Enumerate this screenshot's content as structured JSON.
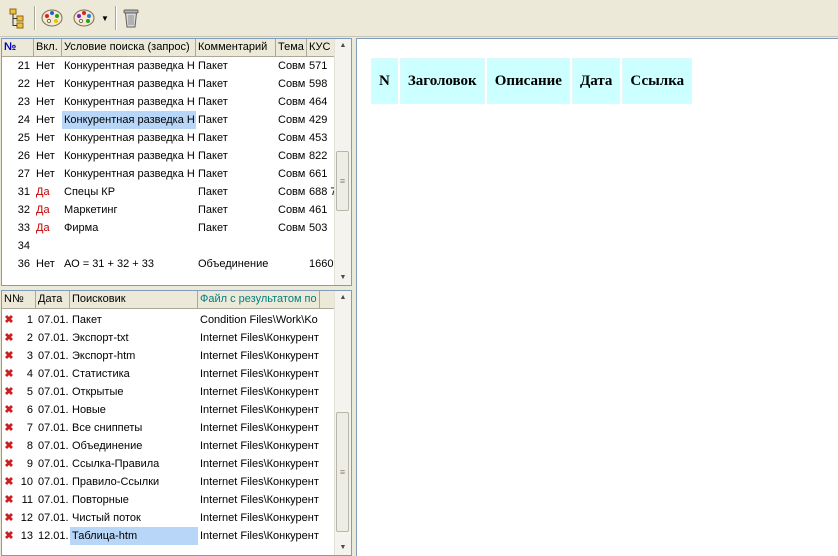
{
  "toolbar": {
    "buttons": [
      {
        "name": "tree-view-button",
        "icon": "tree-icon"
      },
      {
        "name": "palette-button",
        "icon": "palette-icon"
      },
      {
        "name": "palette-dropdown-button",
        "icon": "palette-dropdown-icon"
      },
      {
        "name": "trash-button",
        "icon": "trash-icon"
      }
    ]
  },
  "queries": {
    "headers": [
      "№",
      "Вкл.",
      "Условие поиска (запрос)",
      "Комментарий",
      "Тема",
      "КУС"
    ],
    "rows": [
      {
        "n": "21",
        "on": "Нет",
        "cond": "Конкурентная разведка Н",
        "comment": "Пакет",
        "theme": "Совм",
        "kus": "571",
        "on_red": false,
        "selected": false
      },
      {
        "n": "22",
        "on": "Нет",
        "cond": "Конкурентная разведка Н",
        "comment": "Пакет",
        "theme": "Совм",
        "kus": "598",
        "on_red": false,
        "selected": false
      },
      {
        "n": "23",
        "on": "Нет",
        "cond": "Конкурентная разведка Н",
        "comment": "Пакет",
        "theme": "Совм",
        "kus": "464",
        "on_red": false,
        "selected": false
      },
      {
        "n": "24",
        "on": "Нет",
        "cond": "Конкурентная разведка Н",
        "comment": "Пакет",
        "theme": "Совм",
        "kus": "429",
        "on_red": false,
        "selected": true
      },
      {
        "n": "25",
        "on": "Нет",
        "cond": "Конкурентная разведка Н",
        "comment": "Пакет",
        "theme": "Совм",
        "kus": "453",
        "on_red": false,
        "selected": false
      },
      {
        "n": "26",
        "on": "Нет",
        "cond": "Конкурентная разведка Н",
        "comment": "Пакет",
        "theme": "Совм",
        "kus": "822",
        "on_red": false,
        "selected": false
      },
      {
        "n": "27",
        "on": "Нет",
        "cond": "Конкурентная разведка Н",
        "comment": "Пакет",
        "theme": "Совм",
        "kus": "661",
        "on_red": false,
        "selected": false
      },
      {
        "n": "31",
        "on": "Да",
        "cond": "Спецы КР",
        "comment": "Пакет",
        "theme": "Совм",
        "kus": "688 7",
        "on_red": true,
        "selected": false
      },
      {
        "n": "32",
        "on": "Да",
        "cond": "Маркетинг",
        "comment": "Пакет",
        "theme": "Совм",
        "kus": "461",
        "on_red": true,
        "selected": false
      },
      {
        "n": "33",
        "on": "Да",
        "cond": "Фирма",
        "comment": "Пакет",
        "theme": "Совм",
        "kus": "503",
        "on_red": true,
        "selected": false
      },
      {
        "n": "34",
        "on": "",
        "cond": "",
        "comment": "",
        "theme": "",
        "kus": "",
        "on_red": false,
        "selected": false
      },
      {
        "n": "36",
        "on": "Нет",
        "cond": "АО = 31 + 32 + 33",
        "comment": "Объединение",
        "theme": "",
        "kus": "1660",
        "on_red": false,
        "selected": false
      }
    ],
    "scroll_position": 0.62
  },
  "results": {
    "headers": [
      "N№",
      "Дата",
      "Поисковик",
      "Файл с результатом по"
    ],
    "rows": [
      {
        "n": "1",
        "date": "07.01.",
        "engine": "Пакет",
        "file": "Condition Files\\Work\\Ko",
        "selected": false
      },
      {
        "n": "2",
        "date": "07.01.",
        "engine": "Экспорт-txt",
        "file": "Internet Files\\Конкурент",
        "selected": false
      },
      {
        "n": "3",
        "date": "07.01.",
        "engine": "Экспорт-htm",
        "file": "Internet Files\\Конкурент",
        "selected": false
      },
      {
        "n": "4",
        "date": "07.01.",
        "engine": "Статистика",
        "file": "Internet Files\\Конкурент",
        "selected": false
      },
      {
        "n": "5",
        "date": "07.01.",
        "engine": "Открытые",
        "file": "Internet Files\\Конкурент",
        "selected": false
      },
      {
        "n": "6",
        "date": "07.01.",
        "engine": "Новые",
        "file": "Internet Files\\Конкурент",
        "selected": false
      },
      {
        "n": "7",
        "date": "07.01.",
        "engine": "Все сниппеты",
        "file": "Internet Files\\Конкурент",
        "selected": false
      },
      {
        "n": "8",
        "date": "07.01.",
        "engine": "Объединение",
        "file": "Internet Files\\Конкурент",
        "selected": false
      },
      {
        "n": "9",
        "date": "07.01.",
        "engine": "Ссылка-Правила",
        "file": "Internet Files\\Конкурент",
        "selected": false
      },
      {
        "n": "10",
        "date": "07.01.",
        "engine": "Правило-Ссылки",
        "file": "Internet Files\\Конкурент",
        "selected": false
      },
      {
        "n": "11",
        "date": "07.01.",
        "engine": "Повторные",
        "file": "Internet Files\\Конкурент",
        "selected": false
      },
      {
        "n": "12",
        "date": "07.01.",
        "engine": "Чистый поток",
        "file": "Internet Files\\Конкурент",
        "selected": false
      },
      {
        "n": "13",
        "date": "12.01.",
        "engine": "Таблица-htm",
        "file": "Internet Files\\Конкурент",
        "selected": true
      }
    ],
    "scroll_position": 0.92
  },
  "preview": {
    "columns": [
      "N",
      "Заголовок",
      "Описание",
      "Дата",
      "Ссылка"
    ],
    "header_color": "#ccffff"
  },
  "colors": {
    "selection": "#b8d6f8",
    "enabled_text": "#c00000",
    "delete_icon": "#cc2020",
    "file_header_text": "#008080"
  }
}
